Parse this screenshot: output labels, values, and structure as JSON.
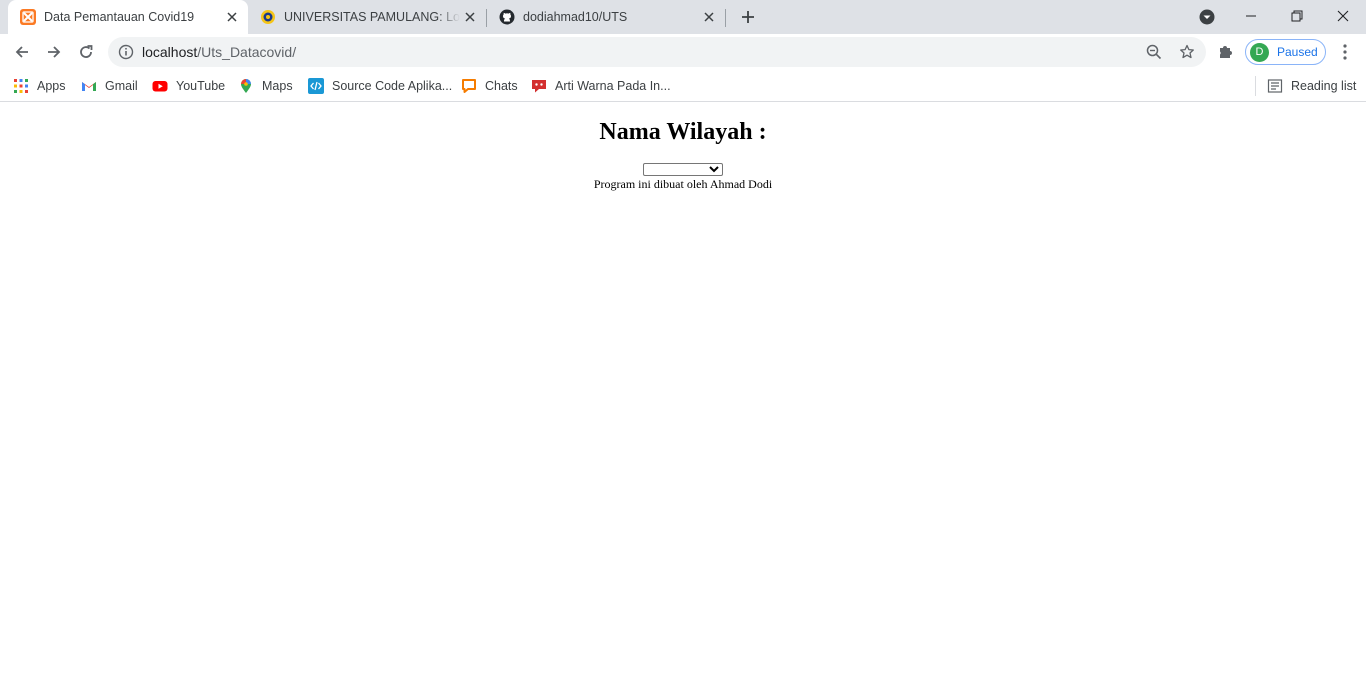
{
  "browser": {
    "tabs": [
      {
        "title": "Data Pemantauan Covid19",
        "icon": "xampp-icon",
        "active": true
      },
      {
        "title": "UNIVERSITAS PAMULANG: Log in",
        "icon": "unpam-logo-icon",
        "active": false
      },
      {
        "title": "dodiahmad10/UTS",
        "icon": "github-icon",
        "active": false
      }
    ],
    "address_host": "localhost",
    "address_path": "/Uts_Datacovid/",
    "profile_initial": "D",
    "profile_status": "Paused",
    "bookmarks": [
      {
        "label": "Apps",
        "icon": "apps-grid-icon"
      },
      {
        "label": "Gmail",
        "icon": "gmail-icon"
      },
      {
        "label": "YouTube",
        "icon": "youtube-icon"
      },
      {
        "label": "Maps",
        "icon": "maps-pin-icon"
      },
      {
        "label": "Source Code Aplika...",
        "icon": "code-icon"
      },
      {
        "label": "Chats",
        "icon": "chat-icon"
      },
      {
        "label": "Arti Warna Pada In...",
        "icon": "speech-bubble-icon"
      }
    ],
    "reading_list": "Reading list"
  },
  "page": {
    "heading": "Nama Wilayah :",
    "region_select_value": "",
    "footer_note": "Program ini dibuat oleh Ahmad Dodi"
  },
  "colors": {
    "tabstrip": "#dee1e6",
    "omnibox": "#f1f3f4",
    "profile_accent": "#1a73e8",
    "avatar": "#34a853"
  }
}
